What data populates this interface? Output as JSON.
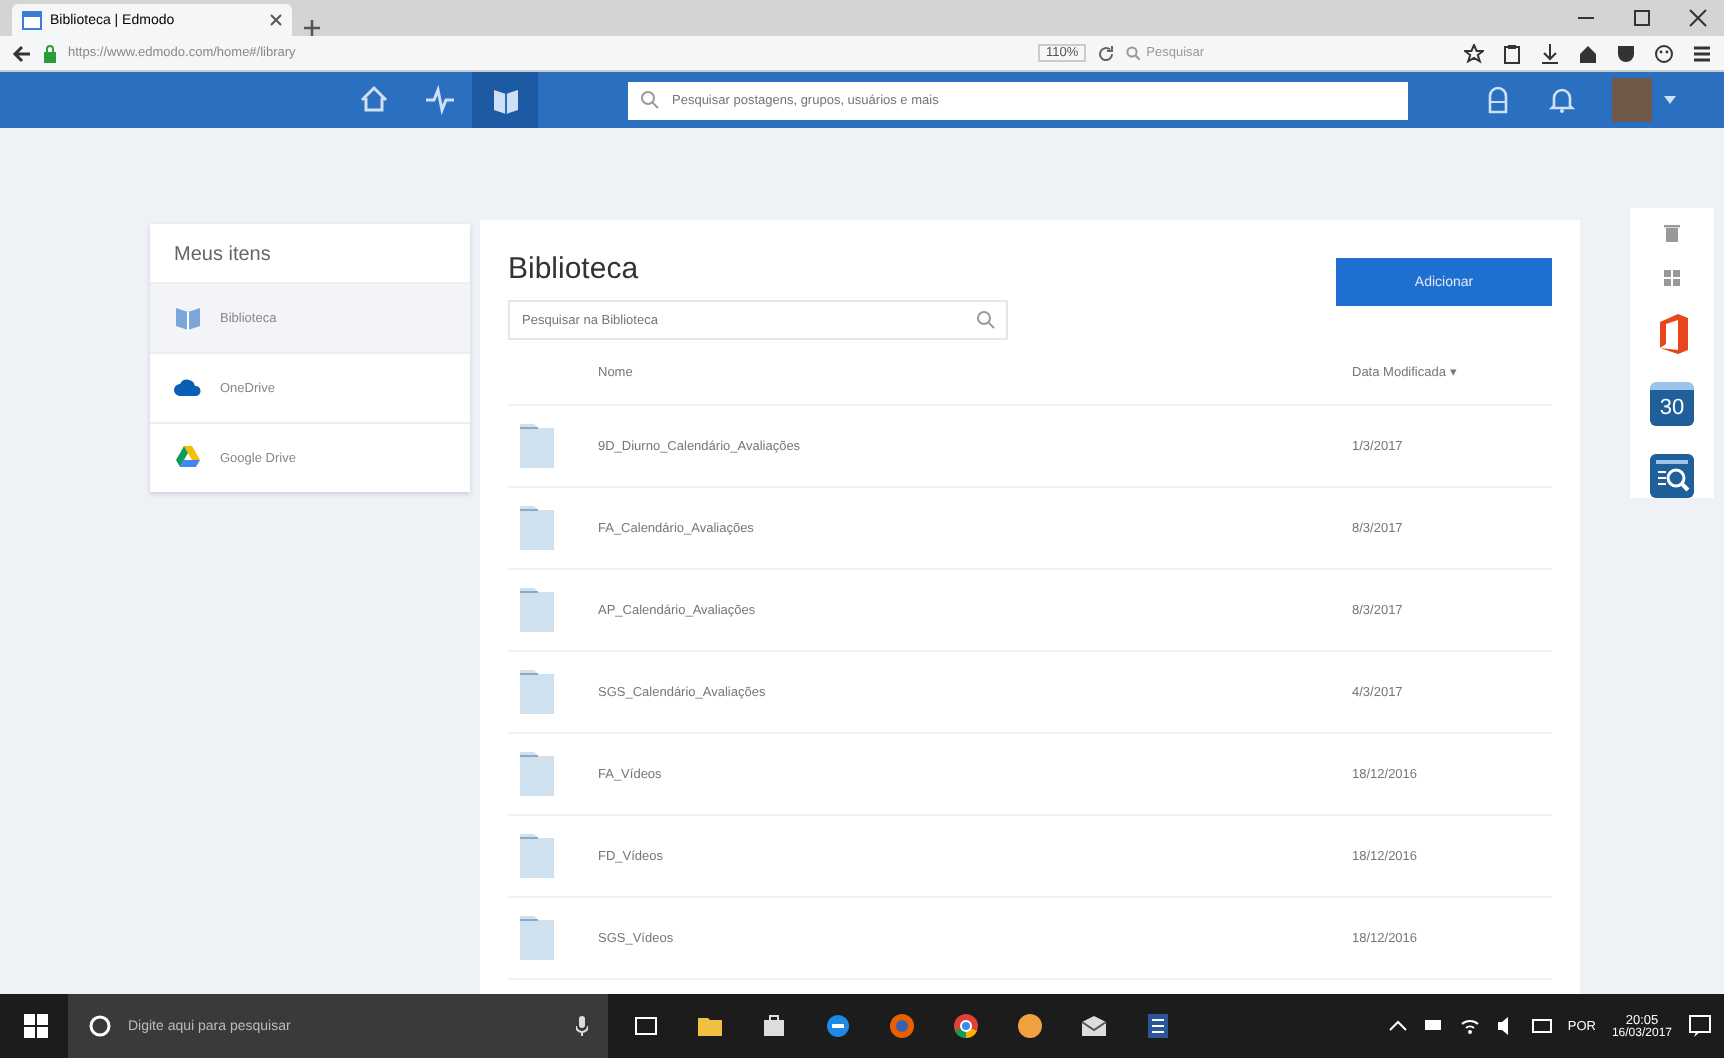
{
  "browser": {
    "tab_title": "Biblioteca | Edmodo",
    "url": "https://www.edmodo.com/home#/library",
    "zoom": "110%",
    "search_placeholder": "Pesquisar"
  },
  "nav": {
    "items": [
      {
        "kind": "home",
        "selected": false
      },
      {
        "kind": "pulse",
        "selected": false
      },
      {
        "kind": "library",
        "selected": true
      }
    ],
    "search_placeholder": "Pesquisar postagens, grupos, usuários e mais"
  },
  "sidebar": {
    "title": "Meus itens",
    "items": [
      {
        "label": "Biblioteca",
        "kind": "library",
        "selected": true
      },
      {
        "label": "OneDrive",
        "kind": "onedrive",
        "selected": false
      },
      {
        "label": "Google Drive",
        "kind": "gdrive",
        "selected": false
      }
    ]
  },
  "library": {
    "title": "Biblioteca",
    "add_button": "Adicionar",
    "search_placeholder": "Pesquisar na Biblioteca",
    "columns": [
      "Nome",
      "Data Modificada ▾"
    ],
    "rows": [
      {
        "name": "9D_Diurno_Calendário_Avaliações",
        "date": "1/3/2017"
      },
      {
        "name": "FA_Calendário_Avaliações",
        "date": "8/3/2017"
      },
      {
        "name": "AP_Calendário_Avaliações",
        "date": "8/3/2017"
      },
      {
        "name": "SGS_Calendário_Avaliações",
        "date": "4/3/2017"
      },
      {
        "name": "FA_Vídeos",
        "date": "18/12/2016"
      },
      {
        "name": "FD_Vídeos",
        "date": "18/12/2016"
      },
      {
        "name": "SGS_Vídeos",
        "date": "18/12/2016"
      }
    ]
  },
  "rail": {
    "calendar_number": "30"
  },
  "taskbar": {
    "search_placeholder": "Digite aqui para pesquisar",
    "language": "POR",
    "time": "20:05",
    "date": "16/03/2017"
  }
}
